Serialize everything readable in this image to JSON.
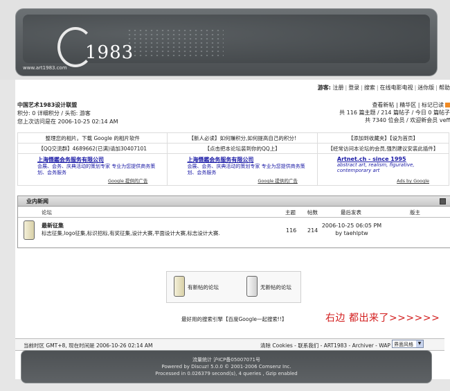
{
  "header": {
    "logo_text": "1983",
    "url_text": "www.art1983.com"
  },
  "topnav": {
    "user_label": "游客:",
    "items": [
      "注册",
      "登录",
      "搜索",
      "在线电影电视",
      "迷你版",
      "帮助"
    ]
  },
  "forum": {
    "title": "中国艺术1983设计联盟",
    "points_line": "积分: 0 详细积分 / 头衔: 游客",
    "last_visit": "您上次访问是在 2006-10-25 02:14 AM",
    "right_links": [
      "查看新帖",
      "精华区",
      "标记已读"
    ],
    "stats1": "共 116 篇主题 / 214 篇帖子 / 今日 0 篇帖子",
    "stats2": "共 7340 位会员 / 欢迎新会员 veff"
  },
  "notices": {
    "row1": [
      "整理您的相片。下载 Google 的相片软件",
      "【新人必读】如何赚积分,如何提高自己的积分!",
      "【添加到收藏夹】【设为首页】"
    ],
    "row2": [
      "【QQ交流群】4689662(已满)请加30407101",
      "【点击把本论坛装到你的QQ上】",
      "【经常访问本论坛的会员,强烈建议安装此插件】"
    ]
  },
  "ads": [
    {
      "title": "上海慑鑑会务服务有限公司",
      "text": "会展、会务、庆典活动的策划专家 专业为您提供商务策划、会务服务",
      "google": "Google 提供的广告"
    },
    {
      "title": "上海慑鑑会务服务有限公司",
      "text": "会展、会务、庆典活动的策划专家 专业为您提供商务策划、会务服务",
      "google": "Google 提供的广告"
    },
    {
      "title": "Artnet.ch - since 1995",
      "text": "abstract art, realism, figurative, contemporary art",
      "google": "Ads by Google"
    }
  ],
  "section": {
    "title": "业内新闻",
    "columns": {
      "forum": "论坛",
      "topics": "主题",
      "posts": "帖数",
      "last": "最后发表",
      "mods": "版主"
    },
    "rows": [
      {
        "name": "最新征集",
        "desc": "标志征集,logo征集,标识招标,有奖征集,设计大赛,平面设计大赛,标志设计大赛.",
        "topics": "116",
        "posts": "214",
        "last_time": "2006-10-25 06:05 PM",
        "last_by": "by taehlptw"
      }
    ]
  },
  "legend": {
    "new": "有新帖的论坛",
    "nonew": "无新帖的论坛"
  },
  "search_line": "最好用的搜索引擎【百度Google一起搜索!!】",
  "annotation": "右边 都出来了>>>>>>",
  "footer": {
    "time": "当前时区 GMT+8, 现在时间是 2006-10-26 02:14 AM",
    "links": "清除 Cookies - 联系我们 - ART1983 - Archiver - WAP",
    "style_select": "界面风格",
    "icp": "流量统计 沪ICP备05007071号",
    "powered": "Powered by Discuz! 5.0.0 © 2001-2006 Comsenz Inc.",
    "processed": "Processed in 0.026379 second(s), 4 queries , Gzip enabled"
  },
  "colors": {
    "accent_red": "#d21c1c",
    "ad_blue": "#1a1aa6",
    "banner": "#4a4e51"
  }
}
